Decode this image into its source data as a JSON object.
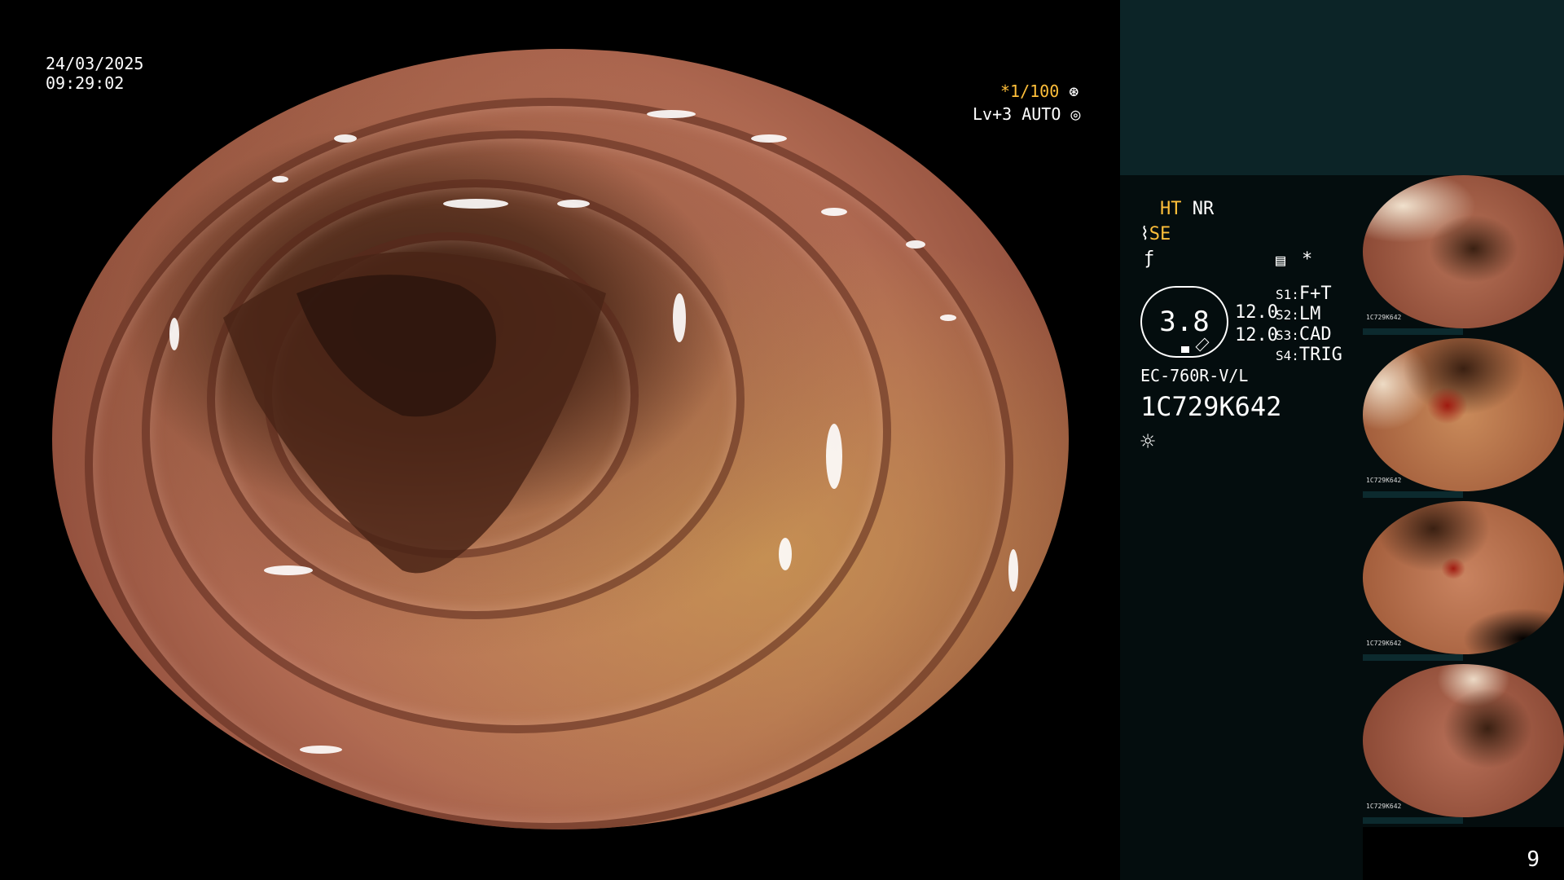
{
  "overlay": {
    "date": "24/03/2025",
    "time": "09:29:02",
    "shutter": "*1/100",
    "level": "Lv+3 AUTO"
  },
  "panel": {
    "ht": "HT",
    "nr": "NR",
    "se": "SE",
    "star": "*",
    "cap_value": "3.8",
    "val_a": "12.0",
    "val_b": "12.0",
    "s1_key": "S1:",
    "s1_val": "F+T",
    "s2_key": "S2:",
    "s2_val": "LM",
    "s3_key": "S3:",
    "s3_val": "CAD",
    "s4_key": "S4:",
    "s4_val": "TRIG",
    "scope_model": "EC-760R-V/L",
    "serial": "1C729K642"
  },
  "thumbnails": [
    {
      "label": "1C729K642"
    },
    {
      "label": "1C729K642"
    },
    {
      "label": "1C729K642"
    },
    {
      "label": "1C729K642"
    }
  ],
  "page_number": "9",
  "colors": {
    "panel_top": "#0c2427",
    "panel_info": "#040d0e",
    "amber": "#ffbf3a",
    "mucosa": "#c27a61"
  }
}
